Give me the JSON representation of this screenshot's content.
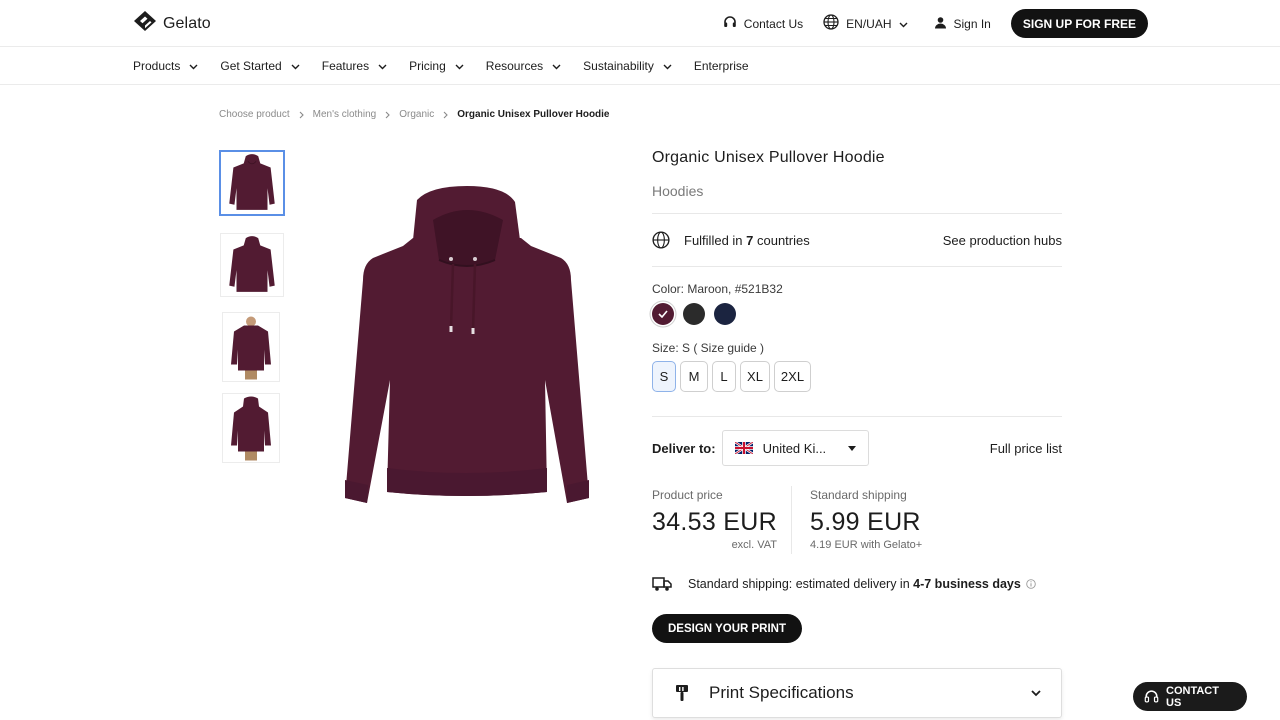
{
  "header": {
    "logo_text": "Gelato",
    "contact_label": "Contact Us",
    "language_label": "EN/UAH",
    "signin_label": "Sign In",
    "signup_label": "SIGN UP FOR FREE"
  },
  "nav": {
    "items": [
      {
        "label": "Products",
        "has_dropdown": true
      },
      {
        "label": "Get Started",
        "has_dropdown": true
      },
      {
        "label": "Features",
        "has_dropdown": true
      },
      {
        "label": "Pricing",
        "has_dropdown": true
      },
      {
        "label": "Resources",
        "has_dropdown": true
      },
      {
        "label": "Sustainability",
        "has_dropdown": true
      },
      {
        "label": "Enterprise",
        "has_dropdown": false
      }
    ]
  },
  "breadcrumb": [
    "Choose product",
    "Men's clothing",
    "Organic",
    "Organic Unisex Pullover Hoodie"
  ],
  "product": {
    "title": "Organic Unisex Pullover Hoodie",
    "category": "Hoodies",
    "fulfilled_prefix": "Fulfilled in ",
    "fulfilled_count": "7",
    "fulfilled_suffix": " countries",
    "production_hubs_link": "See production hubs",
    "color_label": "Color: Maroon, #521B32",
    "colors": [
      {
        "name": "Maroon",
        "hex": "#521B32",
        "selected": true
      },
      {
        "name": "Black",
        "hex": "#2b2b2b",
        "selected": false
      },
      {
        "name": "Navy",
        "hex": "#1b2440",
        "selected": false
      }
    ],
    "size_label": "Size: S ( Size guide )",
    "sizes": [
      {
        "label": "S",
        "selected": true
      },
      {
        "label": "M",
        "selected": false
      },
      {
        "label": "L",
        "selected": false
      },
      {
        "label": "XL",
        "selected": false
      },
      {
        "label": "2XL",
        "selected": false
      }
    ],
    "hoodie_color": "#521B32"
  },
  "delivery": {
    "label": "Deliver to:",
    "country": "United Ki...",
    "full_price_list": "Full price list"
  },
  "pricing": {
    "product_price_label": "Product price",
    "product_price": "34.53 EUR",
    "product_price_note": "excl. VAT",
    "shipping_label": "Standard shipping",
    "shipping_price": "5.99 EUR",
    "shipping_note": "4.19 EUR with Gelato+"
  },
  "shipping_info": {
    "prefix": "Standard shipping: estimated delivery in ",
    "bold": "4-7 business days"
  },
  "cta": {
    "design_label": "DESIGN YOUR PRINT"
  },
  "accordion": {
    "print_specs_label": "Print Specifications"
  },
  "contact_fab": {
    "label": "CONTACT US"
  }
}
